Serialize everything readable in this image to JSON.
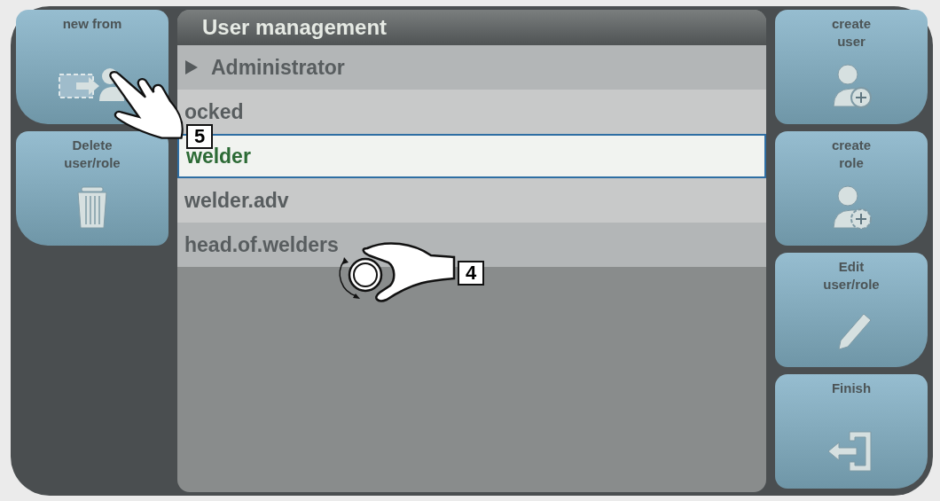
{
  "title": "User management",
  "left_buttons": [
    {
      "label": "new from",
      "kind": "copy-user"
    },
    {
      "label": "Delete\nuser/role",
      "kind": "trash"
    }
  ],
  "items": [
    {
      "label": "Administrator",
      "kind": "group",
      "selected": false
    },
    {
      "label": "ocked",
      "kind": "item",
      "selected": false
    },
    {
      "label": "welder",
      "kind": "item",
      "selected": true
    },
    {
      "label": "welder.adv",
      "kind": "item",
      "selected": false
    },
    {
      "label": "head.of.welders",
      "kind": "item",
      "selected": false
    }
  ],
  "right_buttons": [
    {
      "label": "create\nuser",
      "kind": "user-plus"
    },
    {
      "label": "create\nrole",
      "kind": "user-gear"
    },
    {
      "label": "Edit\nuser/role",
      "kind": "pencil"
    },
    {
      "label": "Finish",
      "kind": "exit"
    }
  ],
  "callouts": [
    {
      "number": "5",
      "kind": "tap"
    },
    {
      "number": "4",
      "kind": "turn"
    }
  ]
}
